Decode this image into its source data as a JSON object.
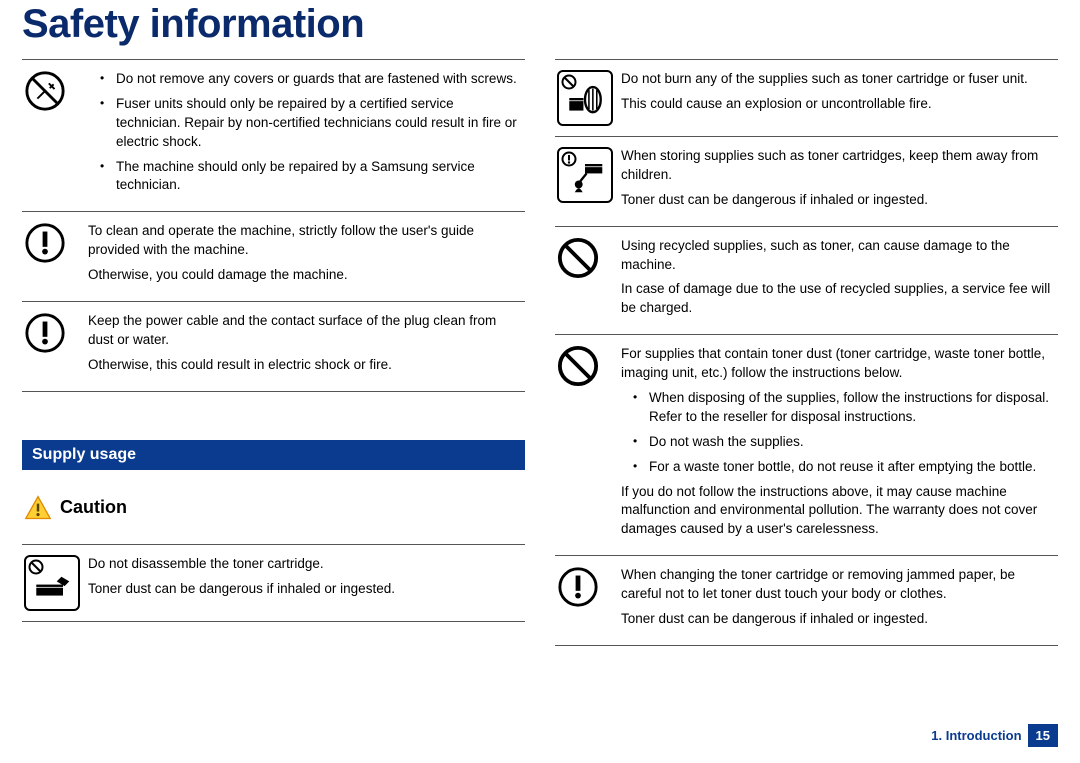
{
  "title": "Safety information",
  "colA": {
    "row1": {
      "b1": "Do not remove any covers or guards that are fastened with screws.",
      "b2": "Fuser units should only be repaired by a certified service technician. Repair by non-certified technicians could result in fire or electric shock.",
      "b3": "The machine should only be repaired by a Samsung service technician."
    },
    "row2": {
      "p1": "To clean and operate the machine, strictly follow the user's guide provided with the machine.",
      "p2": "Otherwise, you could damage the machine."
    },
    "row3": {
      "p1": "Keep the power cable and the contact surface of the plug clean from dust or water.",
      "p2": "Otherwise, this could result in electric shock or fire."
    },
    "section": "Supply usage",
    "cautionLabel": "Caution",
    "row4": {
      "p1": "Do not disassemble the toner cartridge.",
      "p2": "Toner dust can be dangerous if inhaled or ingested."
    }
  },
  "colB": {
    "row1": {
      "p1": "Do not burn any of the supplies such as toner cartridge or fuser unit.",
      "p2": "This could cause an explosion or uncontrollable fire."
    },
    "row2": {
      "p1": "When storing supplies such as toner cartridges, keep them away from children.",
      "p2": "Toner dust can be dangerous if inhaled or ingested."
    },
    "row3": {
      "p1": "Using recycled supplies, such as toner, can cause damage to the machine.",
      "p2": "In case of damage due to the use of recycled supplies, a service fee will be charged."
    },
    "row4": {
      "p1": "For supplies that contain toner dust (toner cartridge, waste toner bottle, imaging unit, etc.) follow the instructions below.",
      "b1": "When disposing of the supplies, follow the instructions for disposal. Refer to the reseller for disposal instructions.",
      "b2": "Do not wash the supplies.",
      "b3": "For a waste toner bottle, do not reuse it after emptying the bottle.",
      "p2": "If you do not follow the instructions above, it may cause machine malfunction and environmental pollution.  The warranty does not cover damages caused by a user's carelessness."
    },
    "row5": {
      "p1": "When changing the toner cartridge or removing jammed paper, be careful not to let toner dust touch your body or clothes.",
      "p2": "Toner dust can be dangerous if inhaled or ingested."
    }
  },
  "footer": {
    "section": "1. Introduction",
    "page": "15"
  }
}
